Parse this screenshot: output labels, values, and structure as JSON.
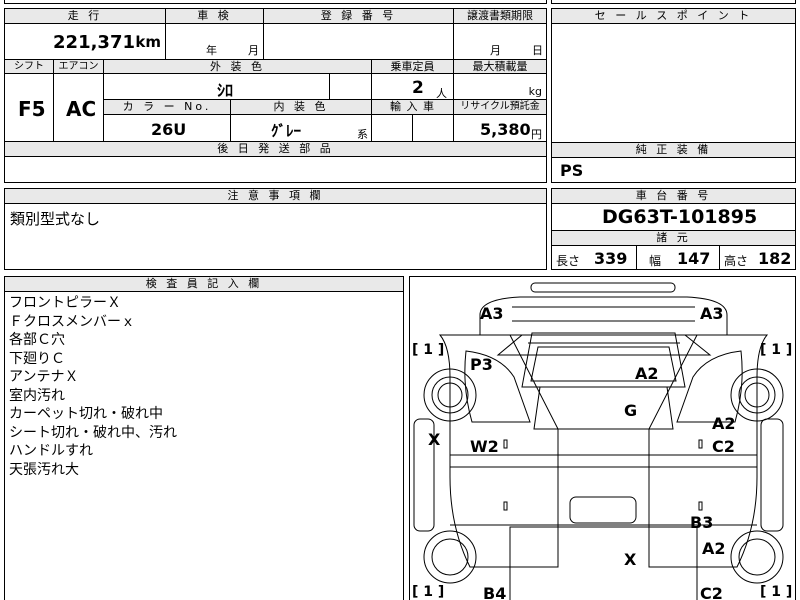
{
  "header": {
    "mileage_label": "走 行",
    "mileage_value": "221,371",
    "mileage_unit": "km",
    "inspection_label": "車 検",
    "inspection_year": "年",
    "inspection_month": "月",
    "registration_label": "登 録 番 号",
    "transfer_label": "譲渡書類期限",
    "transfer_month": "月",
    "transfer_day": "日"
  },
  "specs": {
    "shift_label": "シフト",
    "shift_value": "F5",
    "aircon_label": "エアコン",
    "aircon_value": "AC",
    "exterior_color_label": "外 装 色",
    "exterior_color_value": "ｼﾛ",
    "capacity_label": "乗車定員",
    "capacity_value": "2",
    "capacity_unit": "人",
    "max_load_label": "最大積載量",
    "max_load_unit": "kg",
    "color_no_label": "カ ラ ー No.",
    "color_no_value": "26U",
    "interior_color_label": "内 装 色",
    "interior_color_value": "ｸﾞﾚｰ",
    "interior_color_suffix": "系",
    "import_label": "輸 入 車",
    "recycle_label": "リサイクル預託金",
    "recycle_value": "5,380",
    "recycle_unit": "円",
    "later_parts_label": "後 日 発 送 部 品"
  },
  "sales_point": {
    "label": "セ ー ル ス ポ イ ン ト"
  },
  "genuine_equipment": {
    "label": "純 正 装 備",
    "value": "PS"
  },
  "notes": {
    "label": "注 意 事 項 欄",
    "value": "類別型式なし"
  },
  "chassis": {
    "label": "車 台 番 号",
    "value": "DG63T-101895",
    "specs_label": "諸 元",
    "length_label": "長さ",
    "length_value": "339",
    "width_label": "幅",
    "width_value": "147",
    "height_label": "高さ",
    "height_value": "182"
  },
  "inspector": {
    "label": "検 査 員 記 入 欄",
    "lines": [
      "フロントピラーＸ",
      "Ｆクロスメンバーｘ",
      "各部Ｃ穴",
      "下廻りＣ",
      "アンテナＸ",
      "室内汚れ",
      "カーペット切れ・破れ中",
      "シート切れ・破れ中、汚れ",
      "ハンドルすれ",
      "天張汚れ大"
    ]
  },
  "diagram": {
    "marks": {
      "a3_left": "A3",
      "a3_right": "A3",
      "p3": "P3",
      "a2_roof": "A2",
      "g": "G",
      "a2_right": "A2",
      "c2_right": "C2",
      "x_left": "X",
      "w2": "W2",
      "b3": "B3",
      "a2_right_lower": "A2",
      "x_bed": "X",
      "b4": "B4",
      "c2_bottom": "C2"
    },
    "tire_labels": {
      "front_left": "[ 1 ]",
      "front_right": "[ 1 ]",
      "rear_left": "[ 1 ]",
      "rear_right": "[ 1 ]"
    }
  }
}
